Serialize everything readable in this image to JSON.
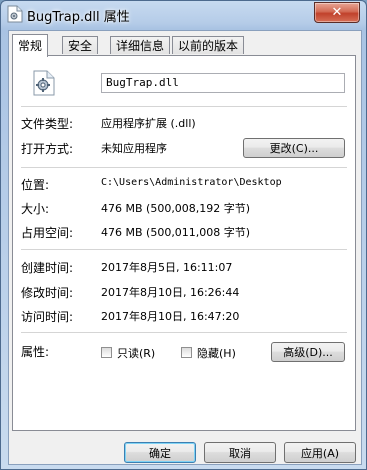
{
  "window": {
    "title": "BugTrap.dll 属性",
    "close_label": "✕"
  },
  "tabs": [
    {
      "label": "常规"
    },
    {
      "label": "安全"
    },
    {
      "label": "详细信息"
    },
    {
      "label": "以前的版本"
    }
  ],
  "general": {
    "file_name": "BugTrap.dll",
    "file_icon": "dll-file-icon",
    "rows": {
      "type_label": "文件类型:",
      "type_value": "应用程序扩展 (.dll)",
      "open_label": "打开方式:",
      "open_value": "未知应用程序",
      "change_button": "更改(C)...",
      "location_label": "位置:",
      "location_value": "C:\\Users\\Administrator\\Desktop",
      "size_label": "大小:",
      "size_value": "476 MB (500,008,192 字节)",
      "disk_label": "占用空间:",
      "disk_value": "476 MB (500,011,008 字节)",
      "created_label": "创建时间:",
      "created_value": "2017年8月5日, 16:11:07",
      "modified_label": "修改时间:",
      "modified_value": "2017年8月10日, 16:26:44",
      "accessed_label": "访问时间:",
      "accessed_value": "2017年8月10日, 16:47:20",
      "attributes_label": "属性:",
      "readonly_label": "只读(R)",
      "hidden_label": "隐藏(H)",
      "advanced_button": "高级(D)..."
    }
  },
  "footer": {
    "ok": "确定",
    "cancel": "取消",
    "apply": "应用(A)"
  }
}
